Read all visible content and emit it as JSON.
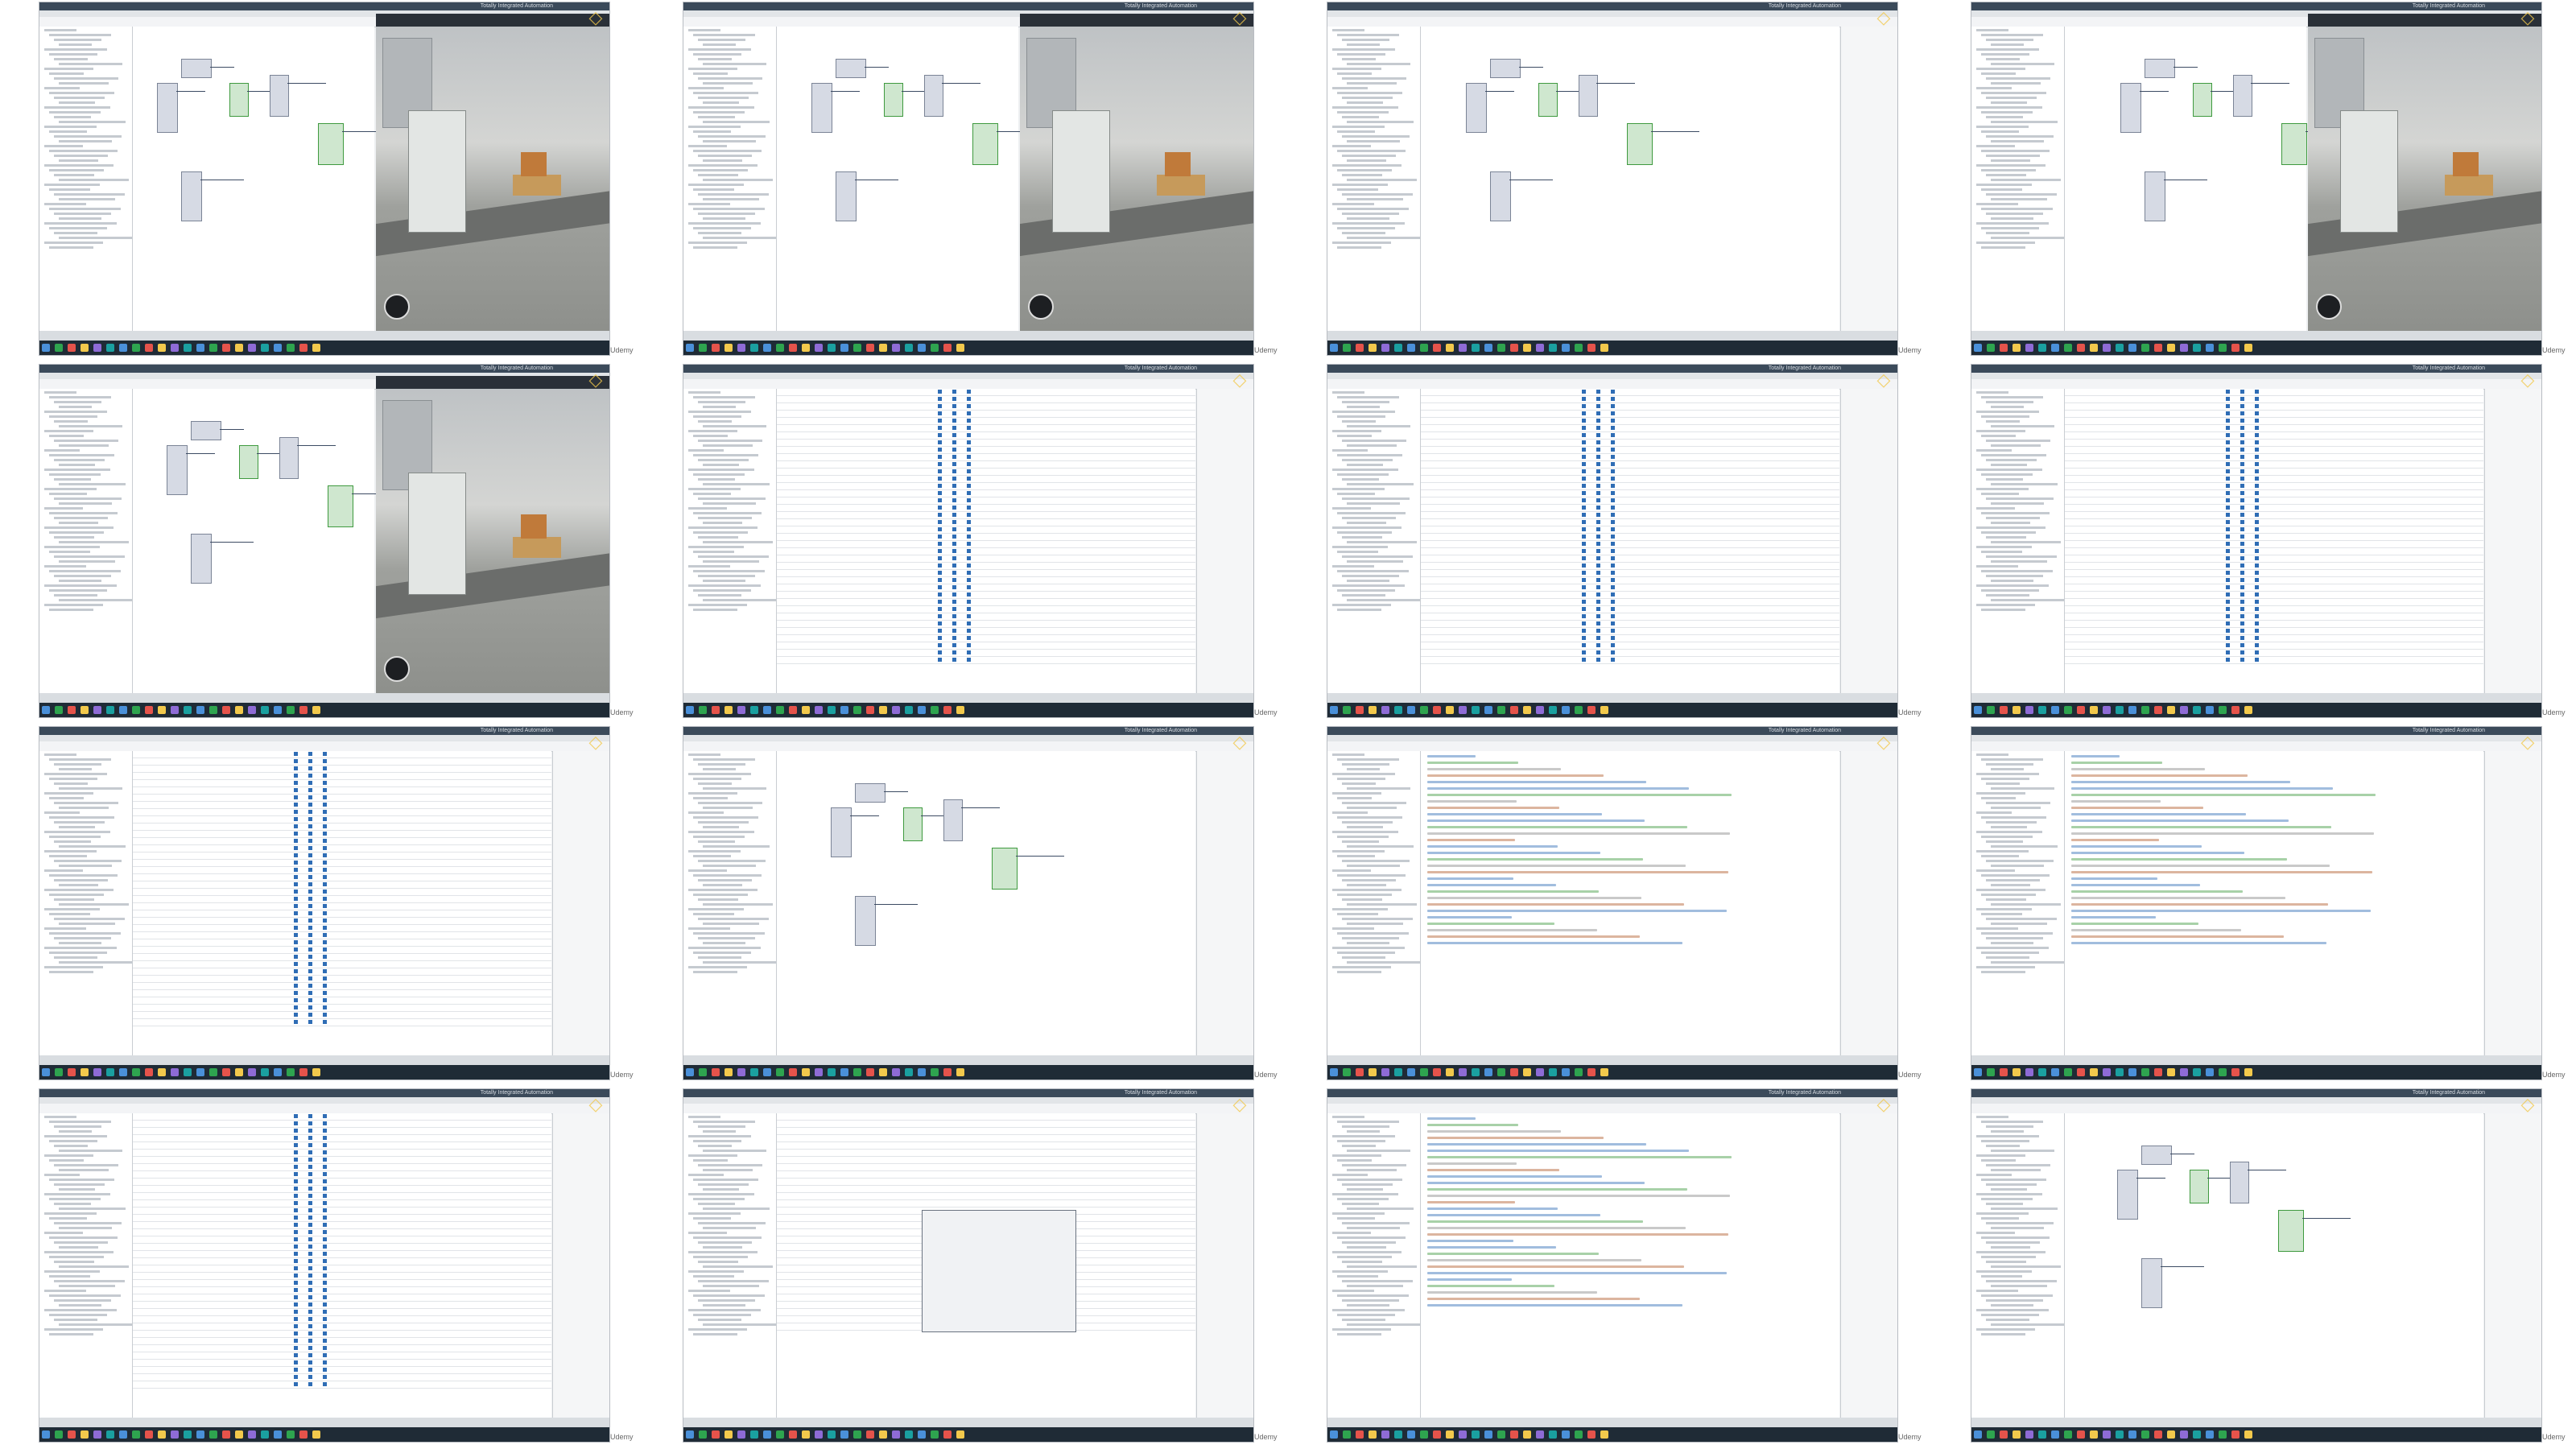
{
  "app": {
    "window_title": "Totally Integrated Automation"
  },
  "watermark": {
    "side_label": "Udemy"
  },
  "colors": {
    "titlebar": "#3b4a5a",
    "taskbar": "#1f2b36",
    "accent_green": "#3f9a3f",
    "accent_blue": "#2f6db5",
    "highlight_yellow": "#f2c94c",
    "siemens_teal": "#0b8a8a"
  },
  "tiles": [
    {
      "view": "ladder_with_sim"
    },
    {
      "view": "ladder_with_sim"
    },
    {
      "view": "ladder"
    },
    {
      "view": "ladder_with_sim"
    },
    {
      "view": "ladder_with_sim"
    },
    {
      "view": "tag_table"
    },
    {
      "view": "tag_table"
    },
    {
      "view": "tag_table"
    },
    {
      "view": "tag_table"
    },
    {
      "view": "ladder"
    },
    {
      "view": "code"
    },
    {
      "view": "code"
    },
    {
      "view": "tag_table"
    },
    {
      "view": "dialog"
    },
    {
      "view": "code"
    },
    {
      "view": "ladder"
    }
  ]
}
